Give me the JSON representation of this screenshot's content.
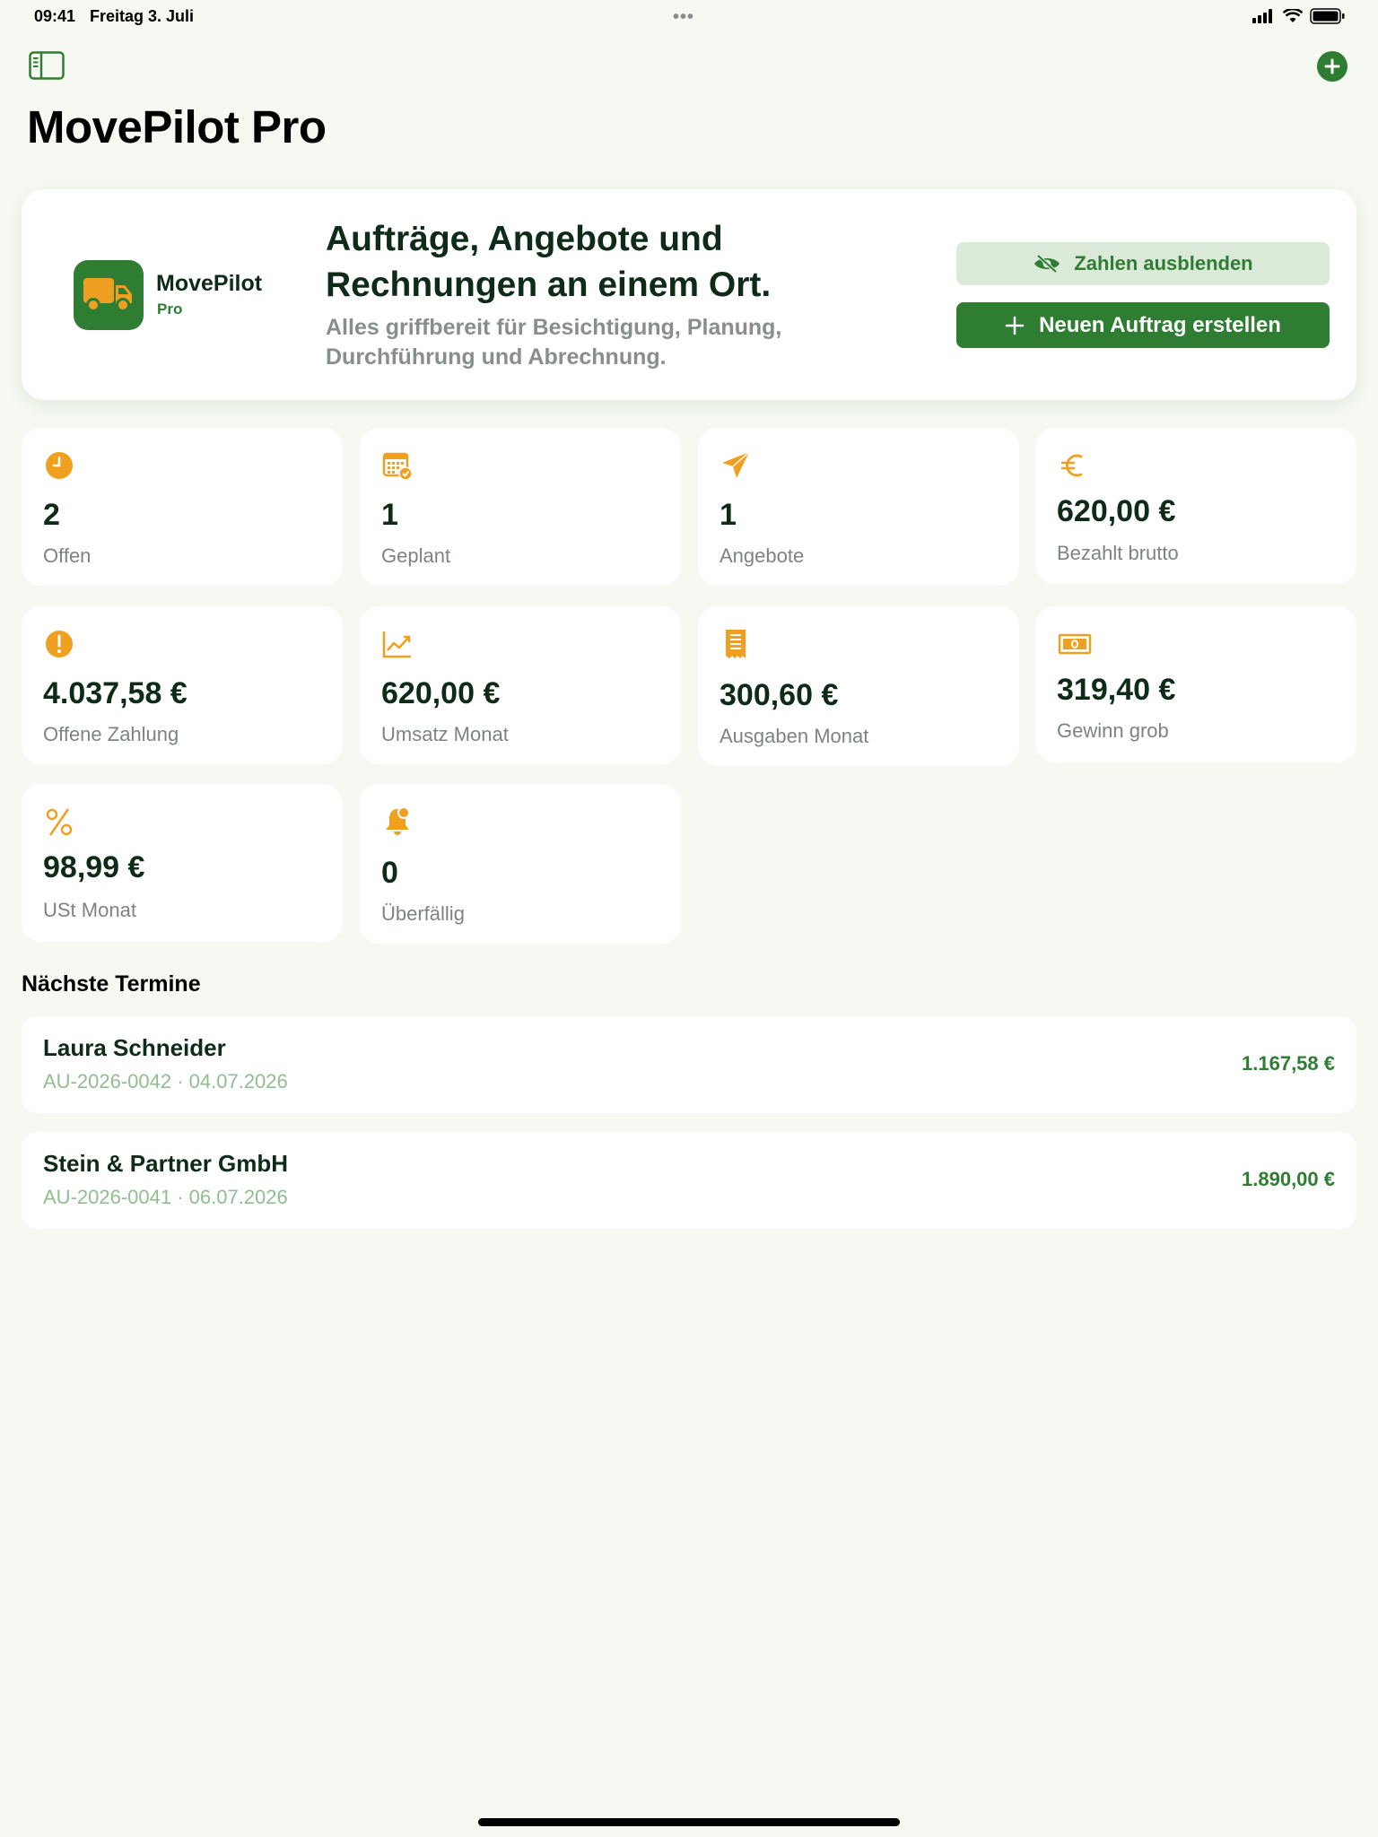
{
  "status_bar": {
    "time": "09:41",
    "date": "Freitag 3. Juli",
    "dots": "•••"
  },
  "header": {
    "title": "MovePilot Pro"
  },
  "hero": {
    "logo_name": "MovePilot",
    "logo_sub": "Pro",
    "heading": "Aufträge, Angebote und Rechnungen an einem Ort.",
    "description": "Alles griffbereit für Besichtigung, Planung, Durchführung und Abrechnung.",
    "hide_button": "Zahlen ausblenden",
    "new_button": "Neuen Auftrag erstellen"
  },
  "stats": [
    {
      "value": "2",
      "label": "Offen",
      "icon": "clock-icon"
    },
    {
      "value": "1",
      "label": "Geplant",
      "icon": "calendar-check-icon"
    },
    {
      "value": "1",
      "label": "Angebote",
      "icon": "paperplane-icon"
    },
    {
      "value": "620,00 €",
      "label": "Bezahlt brutto",
      "icon": "euro-icon"
    },
    {
      "value": "4.037,58 €",
      "label": "Offene Zahlung",
      "icon": "exclamation-icon"
    },
    {
      "value": "620,00 €",
      "label": "Umsatz Monat",
      "icon": "chart-line-icon"
    },
    {
      "value": "300,60 €",
      "label": "Ausgaben Monat",
      "icon": "receipt-icon"
    },
    {
      "value": "319,40 €",
      "label": "Gewinn grob",
      "icon": "banknote-icon"
    },
    {
      "value": "98,99 €",
      "label": "USt Monat",
      "icon": "percent-icon"
    },
    {
      "value": "0",
      "label": "Überfällig",
      "icon": "bell-badge-icon"
    }
  ],
  "appointments": {
    "title": "Nächste Termine",
    "items": [
      {
        "name": "Laura Schneider",
        "meta": "AU-2026-0042 · 04.07.2026",
        "amount": "1.167,58 €"
      },
      {
        "name": "Stein & Partner GmbH",
        "meta": "AU-2026-0041 · 06.07.2026",
        "amount": "1.890,00 €"
      }
    ]
  },
  "colors": {
    "accent": "#2e7d32",
    "icon": "#f0a020",
    "background": "#f5f9f1"
  }
}
